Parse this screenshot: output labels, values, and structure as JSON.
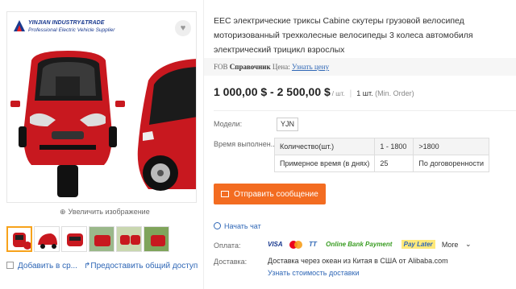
{
  "gallery": {
    "brand_name": "YINJIAN INDUSTRY&TRADE",
    "brand_sub": "Professional Electric Vehicle Supplier",
    "zoom_label": "Увеличить изображение",
    "add_compare_label": "Добавить в ср...",
    "share_label": "Предоставить общий доступ",
    "thumbnails": [
      "thumb-1",
      "thumb-2",
      "thumb-3",
      "thumb-4",
      "thumb-5",
      "thumb-6"
    ],
    "car_color": "#c8181f"
  },
  "product": {
    "title": "EEC электрические триксы Cabine скутеры грузовой велосипед моторизованный трехколесные велосипеды 3 колеса автомобиля электрический трицикл взрослых"
  },
  "fob": {
    "prefix": "FOB",
    "reference": "Справочник",
    "price_label": "Цена:",
    "link": "Узнать цену"
  },
  "price": {
    "range": "1 000,00 $ - 2 500,00 $",
    "unit": "/ шт.",
    "min_qty": "1 шт.",
    "min_label": "(Min. Order)"
  },
  "model": {
    "label": "Модели:",
    "value": "YJN"
  },
  "lead_time": {
    "label": "Время выполнен...",
    "rows": [
      [
        "Количество(шт.)",
        "1 - 1800",
        ">1800"
      ],
      [
        "Примерное время (в днях)",
        "25",
        "По договоренности"
      ]
    ]
  },
  "actions": {
    "send_message": "Отправить сообщение",
    "start_chat": "Начать чат"
  },
  "payment": {
    "label": "Оплата:",
    "methods": [
      "VISA",
      "TT",
      "Online Bank Payment",
      "Pay Later"
    ],
    "more": "More"
  },
  "shipping": {
    "label": "Доставка:",
    "text": "Доставка через океан из Китая в США от Alibaba.com",
    "link": "Узнать стоимость доставки"
  },
  "colors": {
    "accent": "#f36c21",
    "link": "#2f67b6"
  }
}
